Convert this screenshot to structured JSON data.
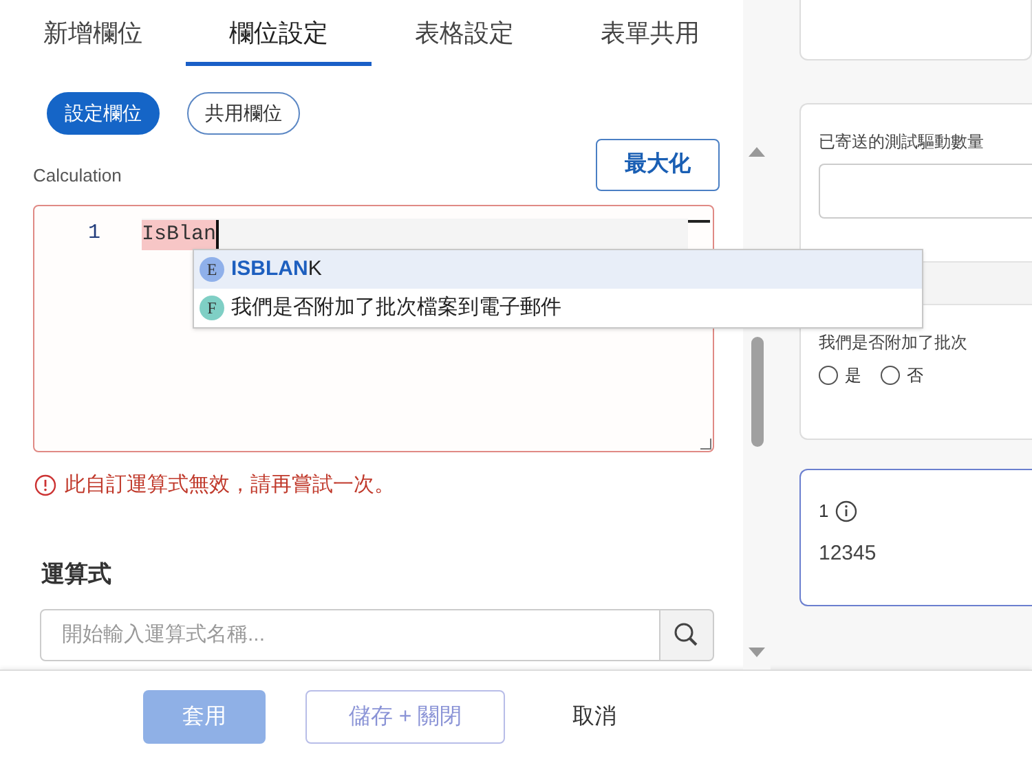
{
  "tabs": [
    {
      "label": "新增欄位",
      "selected": false
    },
    {
      "label": "欄位設定",
      "selected": true
    },
    {
      "label": "表格設定",
      "selected": false
    },
    {
      "label": "表單共用",
      "selected": false
    }
  ],
  "pills": [
    {
      "label": "設定欄位",
      "selected": true
    },
    {
      "label": "共用欄位",
      "selected": false
    }
  ],
  "maximize_button": "最大化",
  "calculation": {
    "label": "Calculation",
    "line_number": "1",
    "code": "IsBlan",
    "error": "此自訂運算式無效，請再嘗試一次。"
  },
  "suggestions": [
    {
      "badge": "E",
      "color": "#8fb0ea",
      "text": "**ISBLAN**K",
      "selected": true
    },
    {
      "badge": "F",
      "color": "#7fcfc5",
      "text": "我們是否附加了批次檔案到電子郵件",
      "selected": false
    }
  ],
  "expressions": {
    "heading": "運算式",
    "placeholder": "開始輸入運算式名稱..."
  },
  "preview": {
    "count_label": "已寄送的測試驅動數量",
    "radio_label": "我們是否附加了批次",
    "radio_options": [
      {
        "label": "是",
        "selected": false
      },
      {
        "label": "否",
        "selected": false
      }
    ],
    "calc_label": "1",
    "calc_value": "12345"
  },
  "footer_buttons": [
    {
      "label": "套用",
      "kind": "primary",
      "disabled": true
    },
    {
      "label": "儲存 + 關閉",
      "kind": "secondary",
      "disabled": true
    },
    {
      "label": "取消",
      "kind": "text",
      "disabled": false
    }
  ]
}
